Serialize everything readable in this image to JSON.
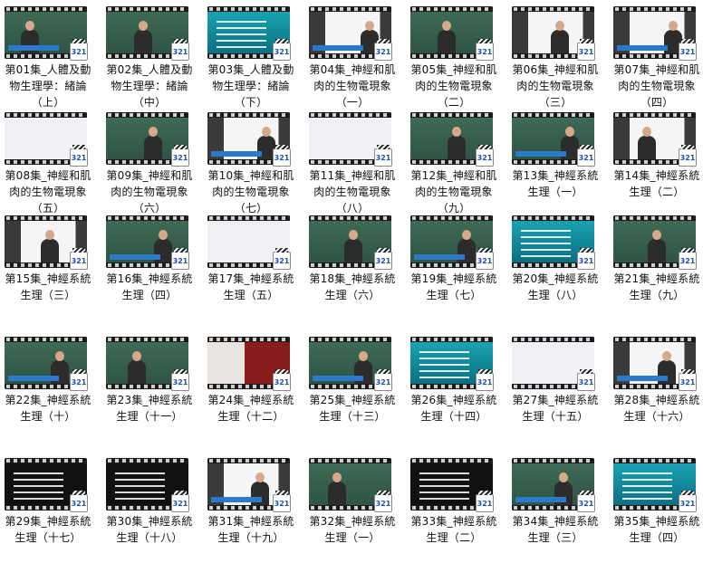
{
  "items": [
    {
      "caption": "第01集_人體及動物生理學：緒論（上）",
      "scene": "board"
    },
    {
      "caption": "第02集_人體及動物生理學：緒論（中）",
      "scene": "board"
    },
    {
      "caption": "第03集_人體及動物生理學：緒論（下）",
      "scene": "blue"
    },
    {
      "caption": "第04集_神經和肌肉的生物電現象（一）",
      "scene": "white"
    },
    {
      "caption": "第05集_神經和肌肉的生物電現象（二）",
      "scene": "board"
    },
    {
      "caption": "第06集_神經和肌肉的生物電現象（三）",
      "scene": "white"
    },
    {
      "caption": "第07集_神經和肌肉的生物電現象（四）",
      "scene": "white"
    },
    {
      "caption": "第08集_神經和肌肉的生物電現象（五）",
      "scene": "diagram"
    },
    {
      "caption": "第09集_神經和肌肉的生物電現象（六）",
      "scene": "board"
    },
    {
      "caption": "第10集_神經和肌肉的生物電現象（七）",
      "scene": "white"
    },
    {
      "caption": "第11集_神經和肌肉的生物電現象（八）",
      "scene": "diagram"
    },
    {
      "caption": "第12集_神經和肌肉的生物電現象（九）",
      "scene": "board"
    },
    {
      "caption": "第13集_神經系統生理（一）",
      "scene": "board"
    },
    {
      "caption": "第14集_神經系統生理（二）",
      "scene": "white"
    },
    {
      "caption": "第15集_神經系統生理（三）",
      "scene": "white"
    },
    {
      "caption": "第16集_神經系統生理（四）",
      "scene": "board"
    },
    {
      "caption": "第17集_神經系統生理（五）",
      "scene": "diagram"
    },
    {
      "caption": "第18集_神經系統生理（六）",
      "scene": "board"
    },
    {
      "caption": "第19集_神經系統生理（七）",
      "scene": "board"
    },
    {
      "caption": "第20集_神經系統生理（八）",
      "scene": "blue"
    },
    {
      "caption": "第21集_神經系統生理（九）",
      "scene": "board"
    },
    {
      "caption": "第22集_神經系統生理（十）",
      "scene": "board"
    },
    {
      "caption": "第23集_神經系統生理（十一）",
      "scene": "board"
    },
    {
      "caption": "第24集_神經系統生理（十二）",
      "scene": "red"
    },
    {
      "caption": "第25集_神經系統生理（十三）",
      "scene": "board"
    },
    {
      "caption": "第26集_神經系統生理（十四）",
      "scene": "blue"
    },
    {
      "caption": "第27集_神經系統生理（十五）",
      "scene": "diagram"
    },
    {
      "caption": "第28集_神經系統生理（十六）",
      "scene": "white"
    },
    {
      "caption": "第29集_神經系統生理（十七）",
      "scene": "dark"
    },
    {
      "caption": "第30集_神經系統生理（十八）",
      "scene": "dark"
    },
    {
      "caption": "第31集_神經系統生理（十九）",
      "scene": "white"
    },
    {
      "caption": "第32集_神經系統生理（一）",
      "scene": "board"
    },
    {
      "caption": "第33集_神經系統生理（二）",
      "scene": "dark"
    },
    {
      "caption": "第34集_神經系統生理（三）",
      "scene": "board"
    },
    {
      "caption": "第35集_神經系統生理（四）",
      "scene": "blue"
    }
  ],
  "badge_label": "321",
  "colors": {
    "caption": "#111111",
    "film_strip": "#1b1b1b",
    "badge_text": "#1d4fa8"
  }
}
